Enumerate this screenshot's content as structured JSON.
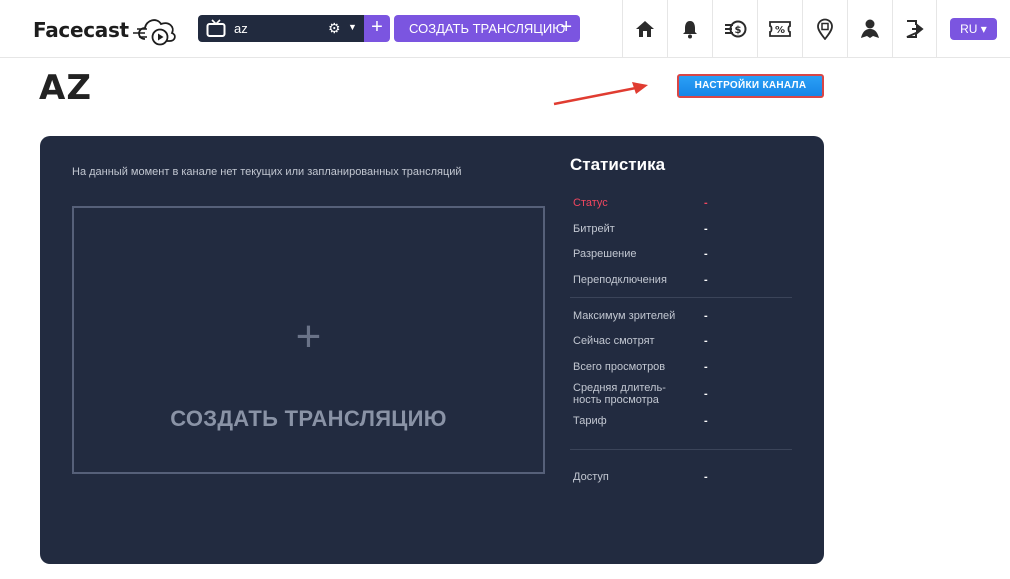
{
  "header": {
    "logo_text": "Facecast",
    "channel": {
      "name": "az"
    },
    "create_stream_label": "СОЗДАТЬ ТРАНСЛЯЦИЮ",
    "nav_icons": [
      "home-icon",
      "bell-icon",
      "coins-icon",
      "discount-icon",
      "location-icon",
      "user-icon",
      "logout-icon"
    ],
    "lang_label": "RU ▾"
  },
  "page": {
    "title": "AZ",
    "settings_button_label": "НАСТРОЙКИ КАНАЛА"
  },
  "panel": {
    "no_streams_text": "На данный момент в канале нет текущих или запланированных трансляций",
    "create_plus": "+",
    "create_label": "СОЗДАТЬ ТРАНСЛЯЦИЮ",
    "stats_title": "Статистика",
    "stats": [
      {
        "label": "Статус",
        "value": "-"
      },
      {
        "label": "Битрейт",
        "value": "-"
      },
      {
        "label": "Разрешение",
        "value": "-"
      },
      {
        "label": "Переподключения",
        "value": "-"
      },
      {
        "label": "Максимум зрителей",
        "value": "-"
      },
      {
        "label": "Сейчас смотрят",
        "value": "-"
      },
      {
        "label": "Всего просмотров",
        "value": "-"
      },
      {
        "label": "Средняя длитель-",
        "label2": "ность просмотра",
        "value": "-"
      },
      {
        "label": "Тариф",
        "value": "-"
      },
      {
        "label": "Доступ",
        "value": "-"
      }
    ]
  },
  "colors": {
    "accent_purple": "#7b55e0",
    "panel_bg": "#222b40",
    "status_red": "#f0465f",
    "settings_blue": "#1785e6",
    "highlight_red": "#d94646"
  }
}
